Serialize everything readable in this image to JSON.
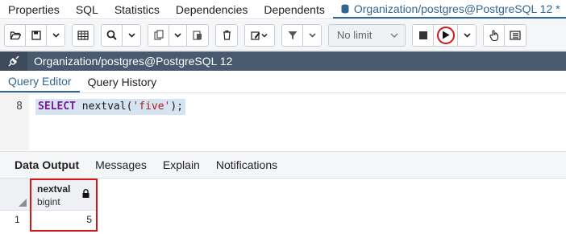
{
  "top_tabs": {
    "properties": "Properties",
    "sql": "SQL",
    "statistics": "Statistics",
    "dependencies": "Dependencies",
    "dependents": "Dependents",
    "query_tab": "Organization/postgres@PostgreSQL 12 *"
  },
  "toolbar": {
    "limit_select": "No limit"
  },
  "connection": {
    "title": "Organization/postgres@PostgreSQL 12"
  },
  "editor_tabs": {
    "query_editor": "Query Editor",
    "query_history": "Query History"
  },
  "editor": {
    "line_number": "8",
    "keyword": "SELECT",
    "function": " nextval(",
    "string": "'five'",
    "end": ");"
  },
  "result_tabs": {
    "data_output": "Data Output",
    "messages": "Messages",
    "explain": "Explain",
    "notifications": "Notifications"
  },
  "grid": {
    "column_name": "nextval",
    "column_type": "bigint",
    "row_number": "1",
    "value": "5"
  },
  "colors": {
    "accent": "#326690",
    "connection_bar": "#4a5a6e",
    "highlight": "#d01818"
  }
}
